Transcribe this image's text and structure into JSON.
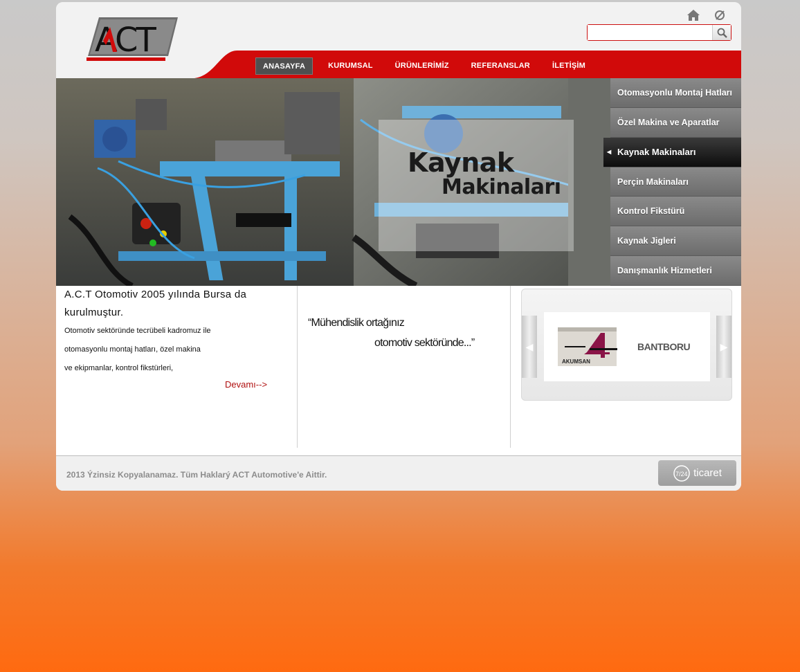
{
  "header": {
    "logo_text": "ACT",
    "search": {
      "value": "",
      "placeholder": ""
    },
    "icons": [
      "home-icon",
      "refresh-icon",
      "search-icon"
    ]
  },
  "nav": {
    "items": [
      "ANASAYFA",
      "KURUMSAL",
      "ÜRÜNLERİMİZ",
      "REFERANSLAR",
      "İLETİŞİM"
    ],
    "active": "ANASAYFA"
  },
  "banner": {
    "title_line1": "Kaynak",
    "title_line2": "Makinaları"
  },
  "side_menu": {
    "items": [
      "Otomasyonlu Montaj Hatları",
      "Özel Makina ve Aparatlar",
      "Kaynak Makinaları",
      "Perçin Makinaları",
      "Kontrol Fikstürü",
      "Kaynak Jigleri",
      "Danışmanlık Hizmetleri"
    ],
    "active": "Kaynak Makinaları"
  },
  "about": {
    "lead": "A.C.T Otomotiv 2005 yılında Bursa da kurulmuştur.",
    "lines": [
      "Otomotiv sektöründe tecrübeli kadromuz ile",
      "otomasyonlu montaj hatları, özel makina",
      "ve ekipmanlar, kontrol fikstürleri,"
    ],
    "more_link": "Devamı-->"
  },
  "slogan": {
    "line1": "“Mühendislik ortağınız",
    "line2": "otomotiv sektöründe...”"
  },
  "references": {
    "logos": [
      "AKUMSAN",
      "BANTBORU"
    ]
  },
  "footer": {
    "copyright": "2013 Ýzinsiz Kopyalanamaz. Tüm Haklarý ACT Automotive'e Aittir.",
    "badge_number": "7/24",
    "badge_text": "ticaret"
  },
  "colors": {
    "brand_red": "#d10a0a",
    "menu_gray": "#7a7a7a",
    "active_dark": "#111111"
  }
}
